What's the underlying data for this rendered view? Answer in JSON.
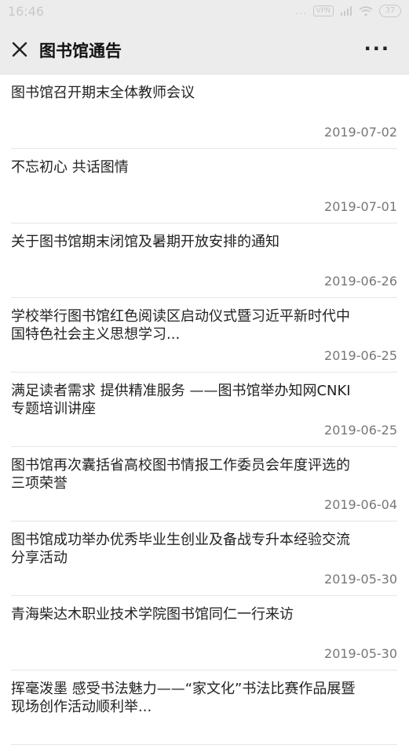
{
  "status_bar": {
    "time": "16:46",
    "signal_dots": "...",
    "vpn": "VPN",
    "battery": "37"
  },
  "header": {
    "title": "图书馆通告",
    "more_label": "···"
  },
  "notices": [
    {
      "title": "图书馆召开期末全体教师会议",
      "date": "2019-07-02"
    },
    {
      "title": "不忘初心 共话图情",
      "date": "2019-07-01"
    },
    {
      "title": "关于图书馆期末闭馆及暑期开放安排的通知",
      "date": "2019-06-26"
    },
    {
      "title": "学校举行图书馆红色阅读区启动仪式暨习近平新时代中国特色社会主义思想学习...",
      "date": "2019-06-25"
    },
    {
      "title": "满足读者需求 提供精准服务 ——图书馆举办知网CNKI专题培训讲座",
      "date": "2019-06-25"
    },
    {
      "title": "图书馆再次囊括省高校图书情报工作委员会年度评选的三项荣誉",
      "date": "2019-06-04"
    },
    {
      "title": "图书馆成功举办优秀毕业生创业及备战专升本经验交流分享活动",
      "date": "2019-05-30"
    },
    {
      "title": "青海柴达木职业技术学院图书馆同仁一行来访",
      "date": "2019-05-30"
    },
    {
      "title": "挥毫泼墨 感受书法魅力——“家文化”书法比赛作品展暨现场创作活动顺利举...",
      "date": ""
    }
  ]
}
